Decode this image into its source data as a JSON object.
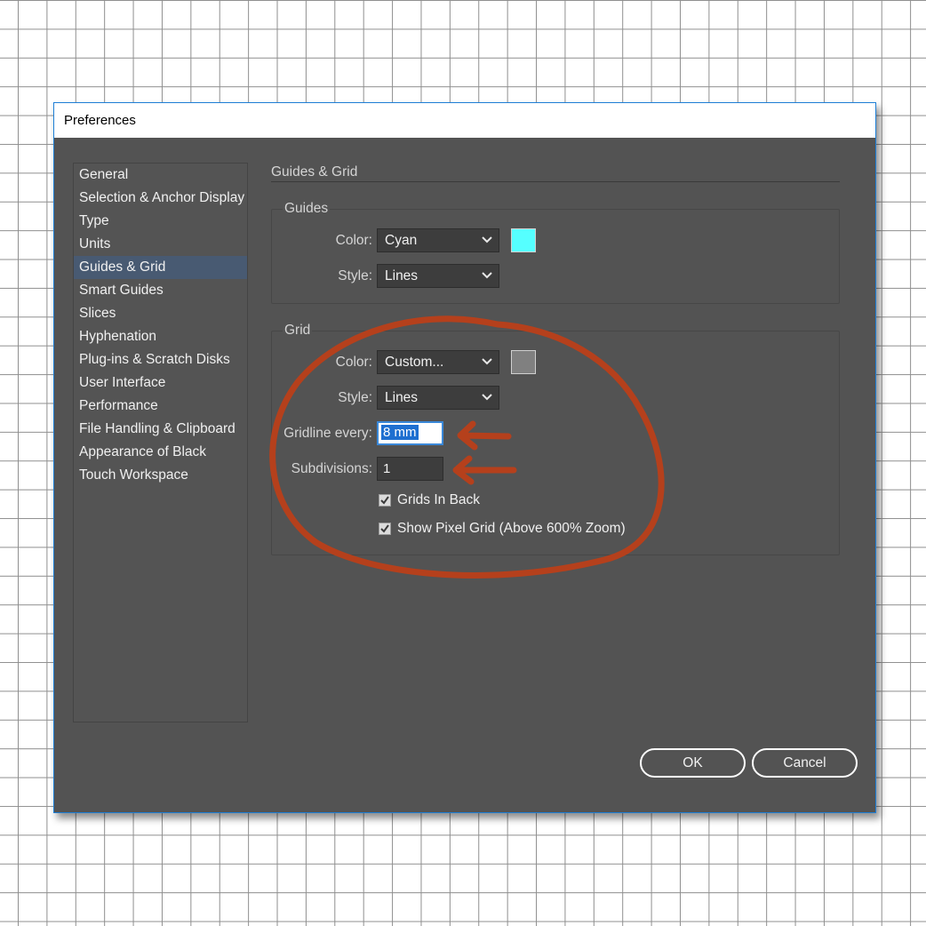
{
  "window": {
    "title": "Preferences"
  },
  "sidebar": {
    "items": [
      {
        "label": "General"
      },
      {
        "label": "Selection & Anchor Display"
      },
      {
        "label": "Type"
      },
      {
        "label": "Units"
      },
      {
        "label": "Guides & Grid",
        "selected": true
      },
      {
        "label": "Smart Guides"
      },
      {
        "label": "Slices"
      },
      {
        "label": "Hyphenation"
      },
      {
        "label": "Plug-ins & Scratch Disks"
      },
      {
        "label": "User Interface"
      },
      {
        "label": "Performance"
      },
      {
        "label": "File Handling & Clipboard"
      },
      {
        "label": "Appearance of Black"
      },
      {
        "label": "Touch Workspace"
      }
    ]
  },
  "panel": {
    "title": "Guides & Grid",
    "guides": {
      "label": "Guides",
      "color_label": "Color:",
      "color_value": "Cyan",
      "color_swatch": "#55ffff",
      "style_label": "Style:",
      "style_value": "Lines"
    },
    "grid": {
      "label": "Grid",
      "color_label": "Color:",
      "color_value": "Custom...",
      "color_swatch": "#808080",
      "style_label": "Style:",
      "style_value": "Lines",
      "gridline_label": "Gridline every:",
      "gridline_value": "8 mm",
      "subdivisions_label": "Subdivisions:",
      "subdivisions_value": "1",
      "grids_in_back_label": "Grids In Back",
      "grids_in_back_checked": true,
      "pixel_grid_label": "Show Pixel Grid (Above 600% Zoom)",
      "pixel_grid_checked": true
    }
  },
  "buttons": {
    "ok": "OK",
    "cancel": "Cancel"
  },
  "annotation_color": "#b5401c"
}
